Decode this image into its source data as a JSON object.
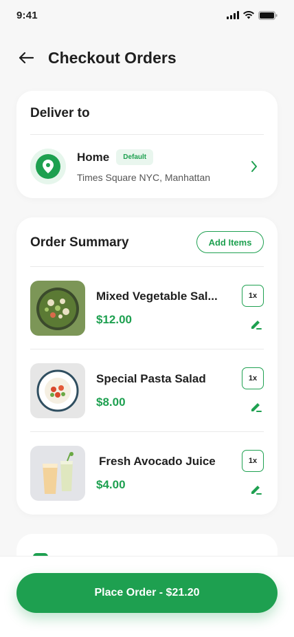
{
  "status_bar": {
    "time": "9:41"
  },
  "header": {
    "title": "Checkout Orders"
  },
  "deliver": {
    "title": "Deliver to",
    "address_name": "Home",
    "badge": "Default",
    "address_line": "Times Square NYC, Manhattan"
  },
  "summary": {
    "title": "Order Summary",
    "add_items_label": "Add Items",
    "items": [
      {
        "name": "Mixed Vegetable Sal...",
        "price": "$12.00",
        "qty": "1x"
      },
      {
        "name": "Special Pasta Salad",
        "price": "$8.00",
        "qty": "1x"
      },
      {
        "name": "Fresh Avocado Juice",
        "price": "$4.00",
        "qty": "1x"
      }
    ]
  },
  "footer": {
    "place_order_label": "Place Order - $21.20"
  },
  "colors": {
    "accent": "#1ea050",
    "background": "#f7f7f7"
  }
}
